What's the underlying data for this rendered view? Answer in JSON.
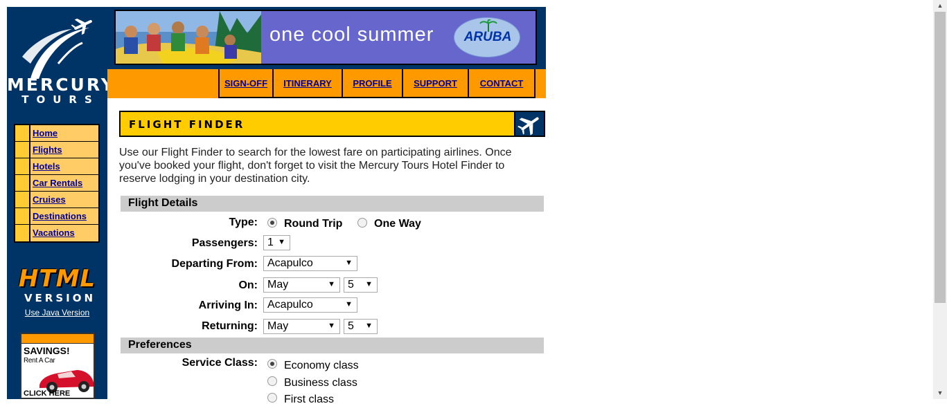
{
  "branding": {
    "logo_text": "MERCURY",
    "logo_subtext": "TOURS",
    "html_badge": "HTML",
    "html_badge_sub": "VERSION",
    "java_link": "Use Java Version"
  },
  "side_nav": {
    "items": [
      {
        "label": "Home"
      },
      {
        "label": "Flights"
      },
      {
        "label": "Hotels"
      },
      {
        "label": "Car Rentals"
      },
      {
        "label": "Cruises"
      },
      {
        "label": "Destinations"
      },
      {
        "label": "Vacations"
      }
    ]
  },
  "ad": {
    "title": "SAVINGS!",
    "subtitle": "Rent A Car",
    "cta": "CLICK HERE"
  },
  "banner": {
    "text": "one cool summer",
    "brand": "ARUBA"
  },
  "top_nav": {
    "items": [
      {
        "label": "SIGN-OFF"
      },
      {
        "label": "ITINERARY"
      },
      {
        "label": "PROFILE"
      },
      {
        "label": "SUPPORT"
      },
      {
        "label": "CONTACT"
      }
    ]
  },
  "finder": {
    "title": "FLIGHT FINDER",
    "intro": "Use our Flight Finder to search for the lowest fare on participating airlines. Once you've booked your flight, don't forget to visit the Mercury Tours Hotel Finder to reserve lodging in your destination city."
  },
  "flight_details": {
    "heading": "Flight Details",
    "type_label": "Type:",
    "round_trip": "Round Trip",
    "one_way": "One Way",
    "passengers_label": "Passengers:",
    "passengers_value": "1",
    "departing_label": "Departing From:",
    "departing_value": "Acapulco",
    "on_label": "On:",
    "on_month": "May",
    "on_day": "5",
    "arriving_label": "Arriving In:",
    "arriving_value": "Acapulco",
    "returning_label": "Returning:",
    "returning_month": "May",
    "returning_day": "5"
  },
  "preferences": {
    "heading": "Preferences",
    "service_class_label": "Service Class:",
    "economy": "Economy class",
    "business": "Business class",
    "first": "First class"
  },
  "colors": {
    "navy": "#003366",
    "orange": "#ff9900",
    "yellow": "#ffcc00",
    "link": "#000099"
  }
}
